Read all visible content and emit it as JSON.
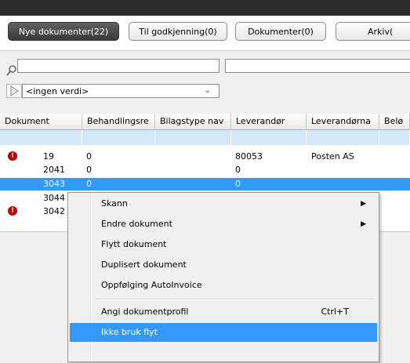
{
  "tabs": [
    {
      "label": "Nye dokumenter(22)",
      "active": true
    },
    {
      "label": "Til godkjenning(0)",
      "active": false
    },
    {
      "label": "Dokumenter(0)",
      "active": false
    },
    {
      "label": "Arkiv(",
      "active": false
    }
  ],
  "filter": {
    "search_value": "",
    "select_value": "<ingen verdi>"
  },
  "grid": {
    "columns": [
      "Dokument",
      "Behandlingsre",
      "Bilagstype nav",
      "Leverandør",
      "Leverandørna",
      "Belø"
    ],
    "rows": [
      {
        "warning": true,
        "dokument": "19",
        "behandling": "0",
        "leverandor": "80053",
        "navn": "Posten AS",
        "selected": false
      },
      {
        "warning": false,
        "dokument": "2041",
        "behandling": "0",
        "leverandor": "0",
        "navn": "",
        "selected": false
      },
      {
        "warning": false,
        "dokument": "3043",
        "behandling": "0",
        "leverandor": "0",
        "navn": "",
        "selected": true
      },
      {
        "warning": false,
        "dokument": "3044",
        "behandling": "",
        "leverandor": "",
        "navn": "",
        "selected": false
      },
      {
        "warning": true,
        "dokument": "3042",
        "behandling": "",
        "leverandor": "",
        "navn": "",
        "selected": false
      }
    ]
  },
  "context_menu": {
    "items": [
      {
        "label": "Skann",
        "submenu": true
      },
      {
        "label": "Endre dokument",
        "submenu": true
      },
      {
        "label": "Flytt dokument"
      },
      {
        "label": "Duplisert dokument"
      },
      {
        "label": "Oppfølging AutoInvoice"
      },
      {
        "label": "Angi dokumentprofil",
        "shortcut": "Ctrl+T"
      },
      {
        "label": "Ikke bruk flyt",
        "highlighted": true
      }
    ]
  },
  "colors": {
    "selection": "#3399ff",
    "filter_row": "#d3e8fb",
    "warning": "#c00000"
  }
}
